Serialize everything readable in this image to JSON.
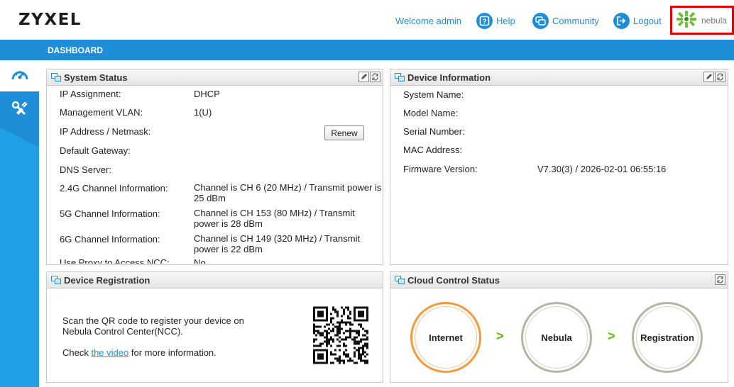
{
  "header": {
    "logo": "ZYXEL",
    "welcome": "Welcome admin",
    "help": "Help",
    "community": "Community",
    "logout": "Logout",
    "nebula": "nebula"
  },
  "nav": {
    "title": "DASHBOARD"
  },
  "sidebar": {
    "items": [
      "dashboard-icon",
      "tools-icon"
    ]
  },
  "system_status": {
    "title": "System Status",
    "rows": [
      {
        "label": "IP Assignment:",
        "value": "DHCP"
      },
      {
        "label": "Management VLAN:",
        "value": "1(U)"
      },
      {
        "label": "IP Address / Netmask:",
        "value": ""
      },
      {
        "label": "Default Gateway:",
        "value": ""
      },
      {
        "label": "DNS Server:",
        "value": ""
      },
      {
        "label": "2.4G Channel Information:",
        "value": "Channel is CH 6 (20 MHz) / Transmit power is 25 dBm"
      },
      {
        "label": "5G Channel Information:",
        "value": "Channel is CH 153 (80 MHz) / Transmit power is 28 dBm"
      },
      {
        "label": "6G Channel Information:",
        "value": "Channel is CH 149 (320 MHz) / Transmit power is 22 dBm"
      },
      {
        "label": "Use Proxy to Access NCC:",
        "value": "No"
      }
    ],
    "renew": "Renew"
  },
  "device_info": {
    "title": "Device Information",
    "rows": [
      {
        "label": "System Name:",
        "value": ""
      },
      {
        "label": "Model Name:",
        "value": ""
      },
      {
        "label": "Serial Number:",
        "value": ""
      },
      {
        "label": "MAC Address:",
        "value": ""
      },
      {
        "label": "Firmware Version:",
        "value": "V7.30(3) / 2026-02-01 06:55:16"
      }
    ]
  },
  "device_registration": {
    "title": "Device Registration",
    "text1": "Scan the QR code to register your device on Nebula Control Center(NCC).",
    "text2_pre": "Check ",
    "link": "the video",
    "text2_post": " for more information."
  },
  "cloud_status": {
    "title": "Cloud Control Status",
    "steps": [
      "Internet",
      "Nebula",
      "Registration"
    ],
    "arrow": ">",
    "colors": {
      "active": "#f39a3c",
      "inactive": "#b9b3a3",
      "arrow": "#5cb800"
    }
  },
  "colors": {
    "accent": "#1f8ed8",
    "highlight": "#e00000"
  }
}
